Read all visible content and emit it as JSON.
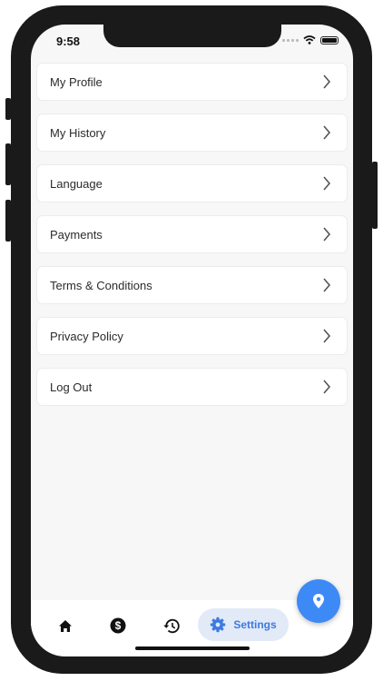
{
  "status_bar": {
    "time": "9:58"
  },
  "menu": {
    "items": [
      {
        "label": "My Profile"
      },
      {
        "label": "My History"
      },
      {
        "label": "Language"
      },
      {
        "label": "Payments"
      },
      {
        "label": "Terms & Conditions"
      },
      {
        "label": "Privacy Policy"
      },
      {
        "label": "Log Out"
      }
    ]
  },
  "fab": {
    "icon": "map-pin-icon"
  },
  "bottom_nav": {
    "items": [
      {
        "icon": "home-icon"
      },
      {
        "icon": "dollar-icon"
      },
      {
        "icon": "history-icon"
      },
      {
        "icon": "gear-icon",
        "label": "Settings",
        "active": true
      }
    ]
  },
  "colors": {
    "accent": "#3d8af7",
    "active_tab_bg": "#e2e9f7",
    "active_tab_text": "#3d7ae0"
  }
}
